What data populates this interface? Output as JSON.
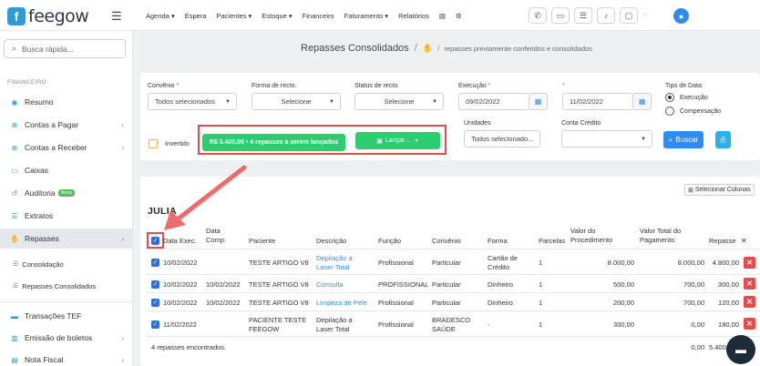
{
  "brand": {
    "name": "feegow",
    "mark": "f"
  },
  "topnav": [
    "Agenda ▾",
    "Espera",
    "Pacientes ▾",
    "Estoque ▾",
    "Financeiro",
    "Faturamento ▾",
    "Relatórios"
  ],
  "search": {
    "placeholder": "Busca rápida..."
  },
  "sidebar": {
    "section": "FINANCEIRO",
    "items": [
      {
        "label": "Resumo",
        "icon": "globe-icon"
      },
      {
        "label": "Contas a Pagar",
        "icon": "arrow-up-icon"
      },
      {
        "label": "Contas a Receber",
        "icon": "arrow-down-icon"
      },
      {
        "label": "Caixas",
        "icon": "cash-icon"
      },
      {
        "label": "Auditoria",
        "icon": "history-icon",
        "badge": "Novo"
      },
      {
        "label": "Extratos",
        "icon": "list-icon"
      },
      {
        "label": "Repasses",
        "icon": "handshake-icon"
      }
    ],
    "subitems": [
      "Consolidação",
      "Repasses Consolidados"
    ],
    "bottom_items": [
      "Transações TEF",
      "Emissão de boletos",
      "Nota Fiscal"
    ]
  },
  "breadcrumb": {
    "title": "Repasses Consolidados",
    "sub": "repasses previamente conferidos e consolidados"
  },
  "filters": {
    "convenio": {
      "label": "Convênio",
      "value": "Todos selecionados"
    },
    "forma": {
      "label": "Forma de recto.",
      "value": "Selecione"
    },
    "status": {
      "label": "Status de recto.",
      "value": "Selecione"
    },
    "execucao": {
      "label": "Execução",
      "from": "09/02/2022",
      "to": "11/02/2022"
    },
    "tipo_data": {
      "label": "Tipo de Data:",
      "options": [
        "Execução",
        "Compensação"
      ],
      "selected": "Execução"
    },
    "unidades": {
      "label": "Unidades",
      "value": "Todos selecionado..."
    },
    "conta_credito": {
      "label": "Conta Crédito",
      "value": ""
    },
    "invertido": "Invertido",
    "summary_pill": "R$ 5.400,00 • 4 repasses a serem lançados",
    "lancar_button": "Lançar...",
    "buscar_button": "Buscar"
  },
  "table": {
    "select_columns": "Selecionar Colunas",
    "group": "JULIA",
    "headers": {
      "data_exec": "Data Exec.",
      "data_comp": "Data Comp.",
      "paciente": "Paciente",
      "descricao": "Descrição",
      "funcao": "Função",
      "convenio": "Convênio",
      "forma": "Forma",
      "parcelas": "Parcelas",
      "valor_proc": "Valor do Procedimento",
      "valor_total": "Valor Total do Pagamento",
      "repasse": "Repasse"
    },
    "rows": [
      {
        "data_exec": "10/02/2022",
        "data_comp": "",
        "paciente": "TESTE ARTIGO V8",
        "descricao": "Depilação a Laser Total",
        "funcao": "Profissional",
        "convenio": "Particular",
        "forma": "Cartão de Crédito",
        "parcelas": "1",
        "valor_proc": "8.000,00",
        "valor_total": "8.000,00",
        "repasse": "4.800,00"
      },
      {
        "data_exec": "10/02/2022",
        "data_comp": "10/02/2022",
        "paciente": "TESTE ARTIGO V8",
        "descricao": "Consulta",
        "funcao": "PROFISSIONAL",
        "convenio": "Particular",
        "forma": "Dinheiro",
        "parcelas": "1",
        "valor_proc": "500,00",
        "valor_total": "700,00",
        "repasse": "300,00"
      },
      {
        "data_exec": "10/02/2022",
        "data_comp": "10/02/2022",
        "paciente": "TESTE ARTIGO V8",
        "descricao": "Limpeza de Pele",
        "funcao": "Profissional",
        "convenio": "Particular",
        "forma": "Dinheiro",
        "parcelas": "1",
        "valor_proc": "200,00",
        "valor_total": "700,00",
        "repasse": "120,00"
      },
      {
        "data_exec": "11/02/2022",
        "data_comp": "",
        "paciente": "PACIENTE TESTE FEEGOW",
        "descricao": "Depilação a Laser Total",
        "funcao": "Profissional",
        "convenio": "BRADESCO SAÚDE",
        "forma": "-",
        "parcelas": "1",
        "valor_proc": "300,00",
        "valor_total": "0,00",
        "repasse": "180,00"
      }
    ],
    "footer": {
      "count": "4 repasses encontrados.",
      "total_pag": "0,00",
      "total_rep": "5.400"
    }
  }
}
